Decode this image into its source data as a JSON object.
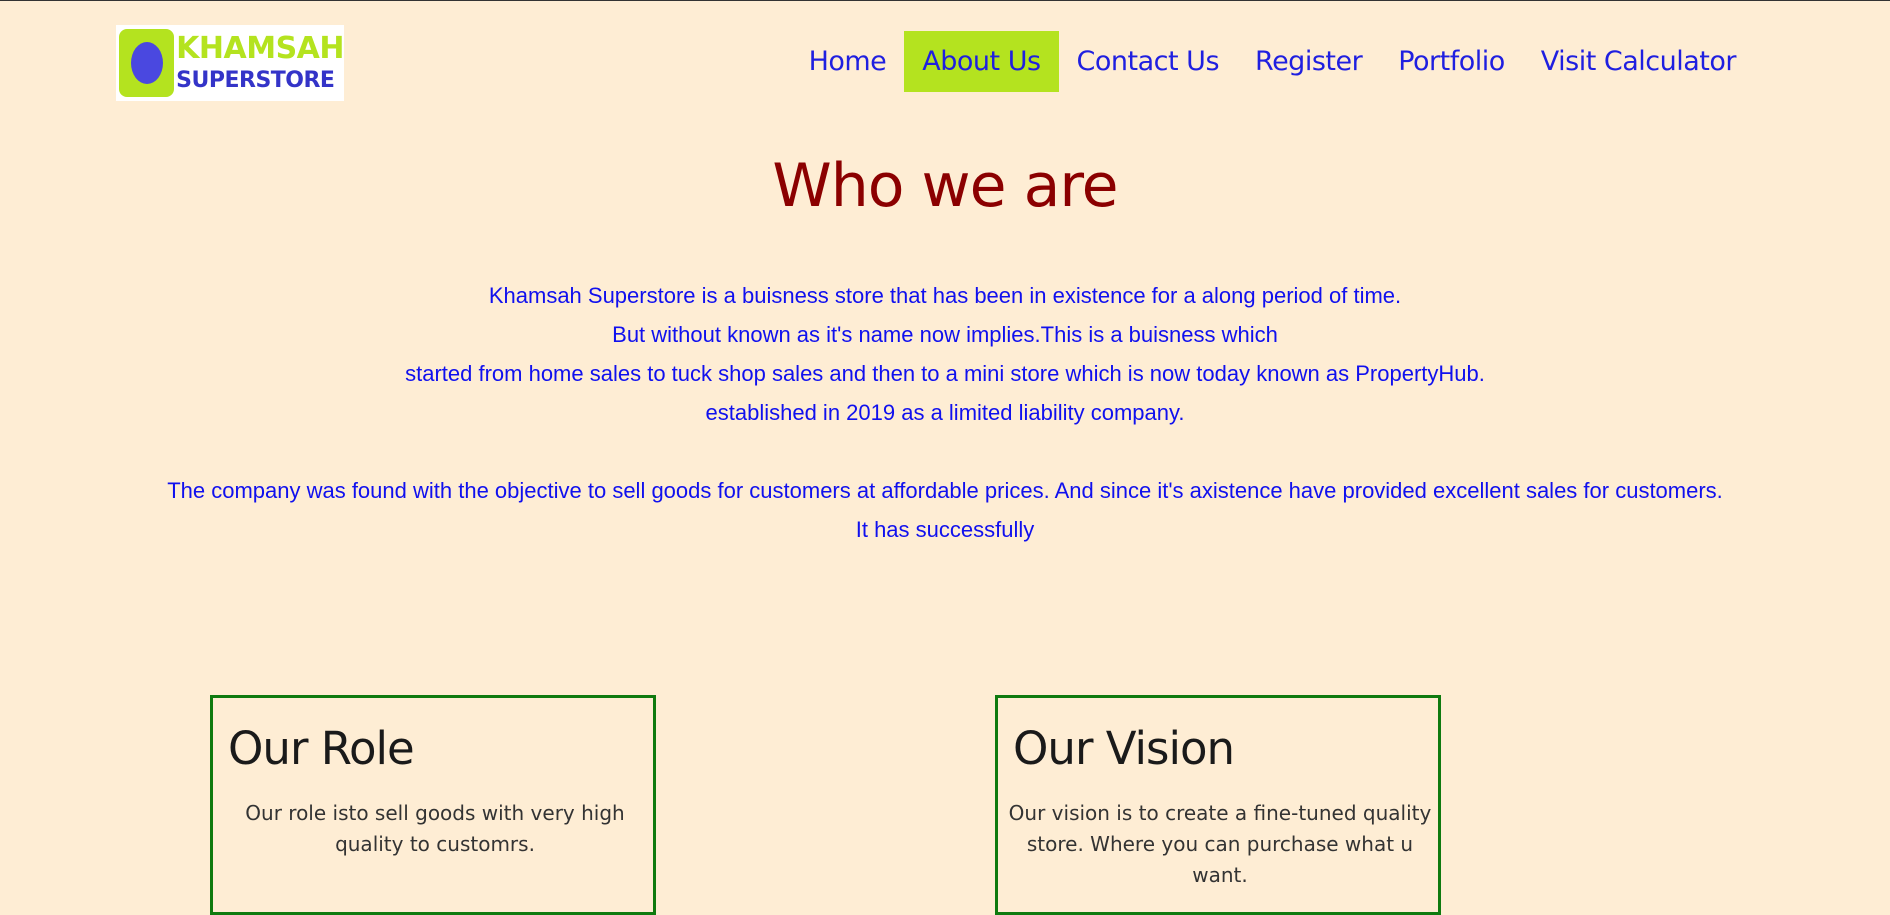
{
  "logo": {
    "line1": "KHAMSAH",
    "line2": "SUPERSTORE"
  },
  "nav": {
    "items": [
      {
        "label": "Home",
        "active": false
      },
      {
        "label": "About Us",
        "active": true
      },
      {
        "label": "Contact Us",
        "active": false
      },
      {
        "label": "Register",
        "active": false
      },
      {
        "label": "Portfolio",
        "active": false
      },
      {
        "label": "Visit Calculator",
        "active": false
      }
    ]
  },
  "main": {
    "title": "Who we are",
    "paragraph1": [
      "Khamsah Superstore is a buisness store that has been in existence for a along period of time.",
      "But without known as it's name now implies.This is a buisness which",
      "started from home sales to tuck shop sales and then to a mini store which is now today known as PropertyHub.",
      "established in 2019 as a limited liability company."
    ],
    "paragraph2": [
      "The company was found with the objective to sell goods for customers at affordable prices. And since it's axistence have provided excellent sales for customers.",
      "It has successfully"
    ]
  },
  "cards": {
    "role": {
      "title": "Our Role",
      "text": "Our role isto sell goods with very high quality to customrs."
    },
    "vision": {
      "title": "Our Vision",
      "text": "Our vision is to create a fine-tuned quality store. Where you can purchase what u want."
    }
  },
  "colors": {
    "background": "#FEEDD4",
    "accent": "#B4E31F",
    "link": "#1F1FE0",
    "title": "#8B0000",
    "body_text": "#1010EE",
    "card_border": "#0F7A0F"
  }
}
